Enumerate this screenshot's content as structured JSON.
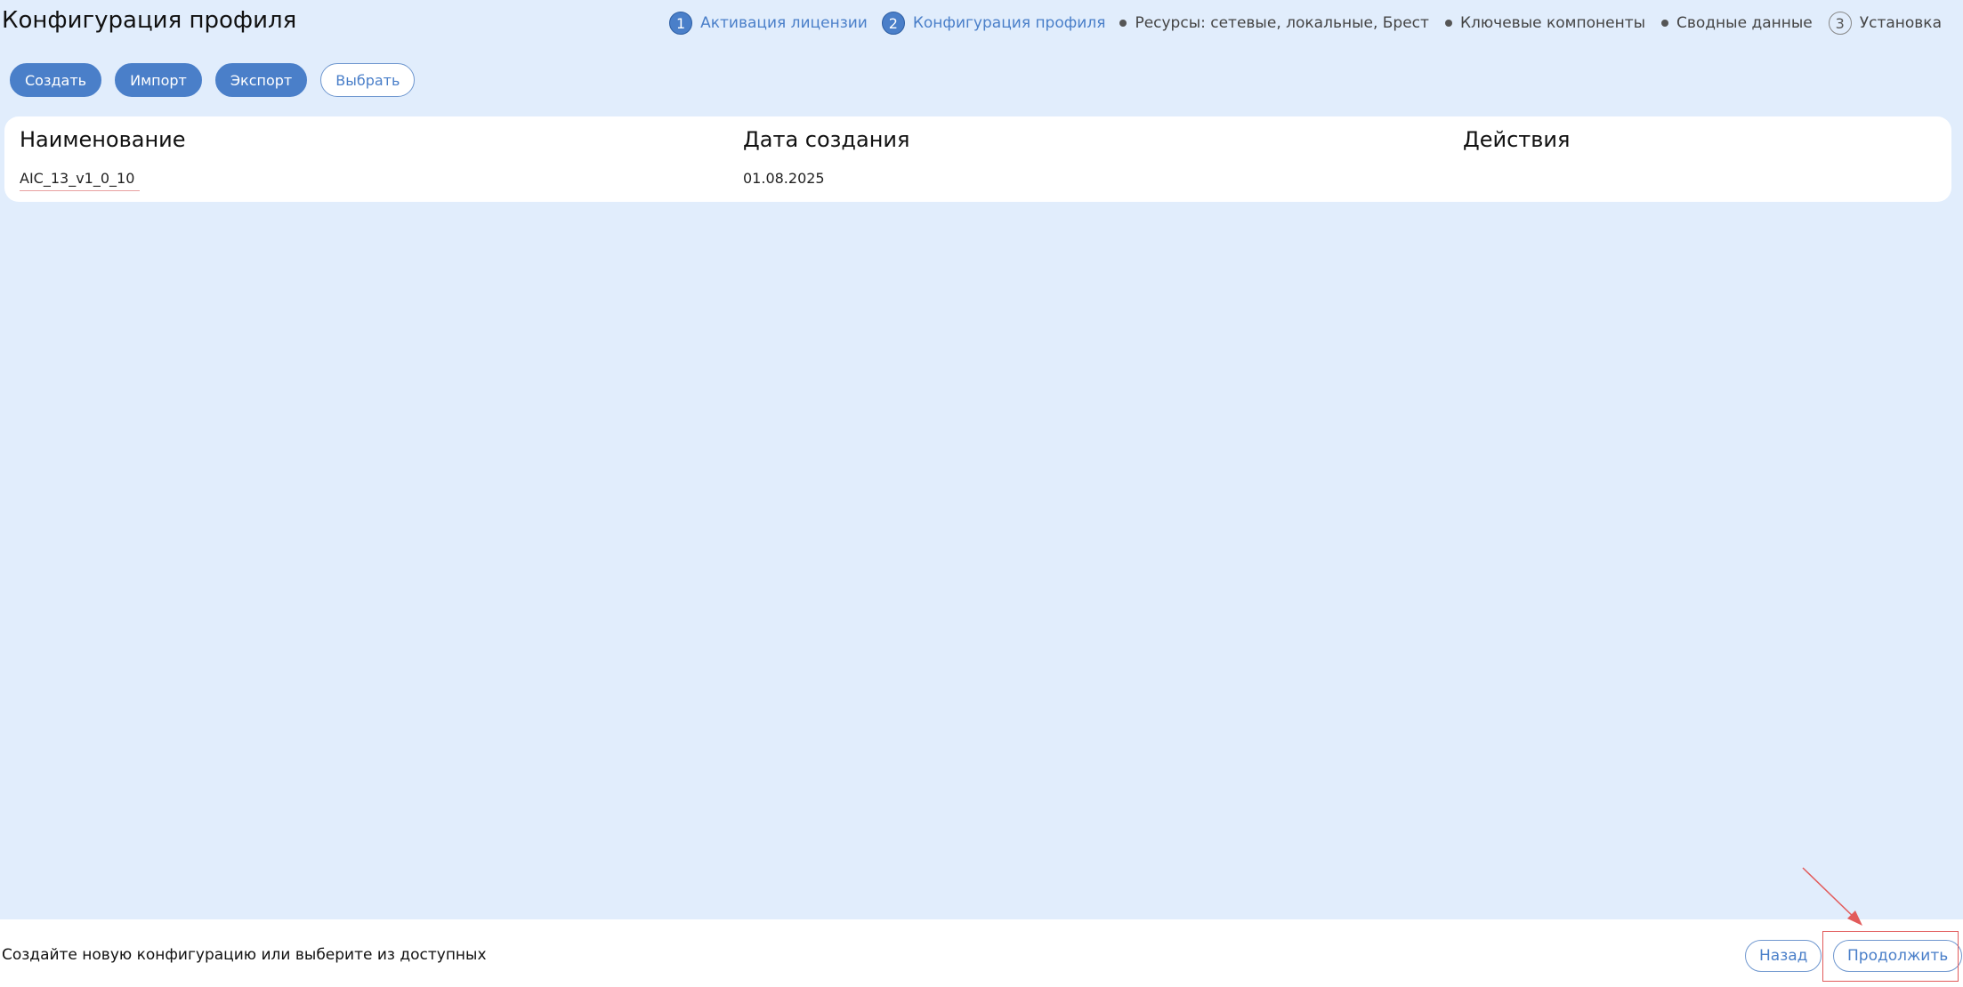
{
  "page": {
    "title": "Конфигурация профиля"
  },
  "stepper": {
    "steps": [
      {
        "number": "1",
        "label": "Активация лицензии",
        "state": "done"
      },
      {
        "number": "2",
        "label": "Конфигурация профиля",
        "state": "current"
      },
      {
        "label": "Ресурсы: сетевые, локальные, Брест",
        "state": "sub"
      },
      {
        "label": "Ключевые компоненты",
        "state": "sub"
      },
      {
        "label": "Сводные данные",
        "state": "sub"
      },
      {
        "number": "3",
        "label": "Установка",
        "state": "pending"
      }
    ]
  },
  "toolbar": {
    "create_label": "Создать",
    "import_label": "Импорт",
    "export_label": "Экспорт",
    "select_label": "Выбрать"
  },
  "table": {
    "columns": [
      "Наименование",
      "Дата создания",
      "Действия"
    ],
    "rows": [
      {
        "name": "AIC_13_v1_0_10",
        "created": "01.08.2025",
        "actions": ""
      }
    ]
  },
  "footer": {
    "hint": "Создайте новую конфигурацию или выберите из доступных",
    "back_label": "Назад",
    "next_label": "Продолжить"
  },
  "colors": {
    "background": "#e1edfc",
    "accent": "#4a7fc9",
    "annotation": "#e25b5b"
  }
}
